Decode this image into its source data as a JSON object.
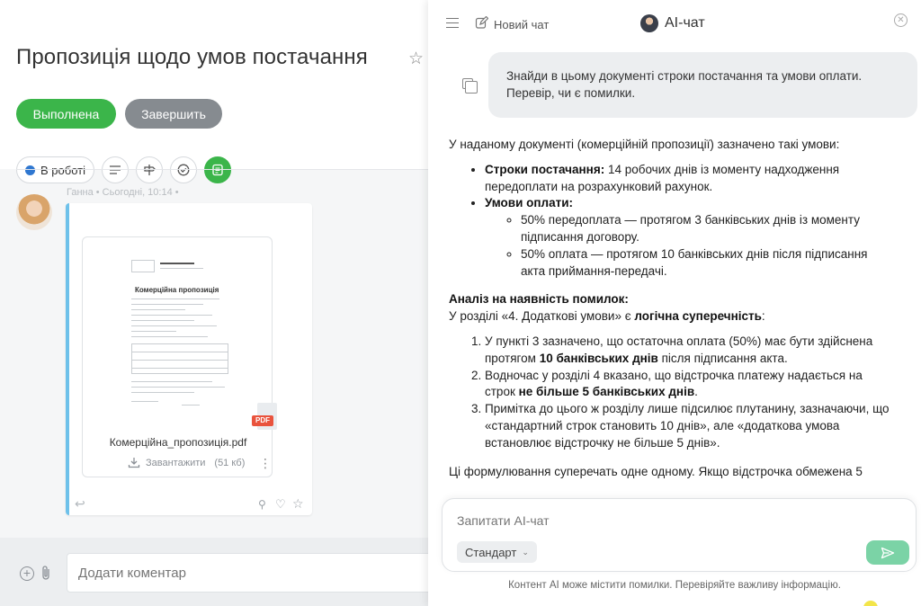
{
  "task": {
    "title": "Пропозиція щодо умов постачання",
    "done_button": "Выполнена",
    "finish_button": "Завершить",
    "status_label": "В роботі",
    "comment_author_meta": "Ганна • Сьогодні, 10:14 •",
    "file": {
      "preview_title": "Комерційна пропозиція",
      "name": "Комерційна_пропозиція.pdf",
      "type_badge": "PDF",
      "download_label": "Завантажити",
      "size": "(51 кб)"
    },
    "comment_placeholder": "Додати коментар"
  },
  "ai_chat": {
    "new_chat_label": "Новий чат",
    "title": "AI-чат",
    "user_message": "Знайди в цьому документі строки постачання та умови оплати. Перевір, чи є помилки.",
    "answer": {
      "intro": "У наданому документі (комерційній пропозиції) зазначено такі умови:",
      "delivery_label": "Строки постачання:",
      "delivery_text": " 14 робочих днів із моменту надходження передоплати на розрахунковий рахунок.",
      "payment_label": "Умови оплати:",
      "payment_items": [
        "50% передоплата — протягом 3 банківських днів із моменту підписання договору.",
        "50% оплата — протягом 10 банківських днів після підписання акта приймання-передачі."
      ],
      "analysis_title": "Аналіз на наявність помилок:",
      "analysis_lead": "У розділі «4. Додаткові умови» є ",
      "analysis_bold": "логічна суперечність",
      "analysis_end": ":",
      "point1_a": "У пункті 3 зазначено, що остаточна оплата (50%) має бути здійснена протягом ",
      "point1_b": "10 банківських днів",
      "point1_c": " після підписання акта.",
      "point2_a": "Водночас у розділі 4 вказано, що відстрочка платежу надається на строк ",
      "point2_b": "не більше 5 банківських днів",
      "point2_c": ".",
      "point3": "Примітка до цього ж розділу лише підсилює плутанину, зазначаючи, що «стандартний строк становить 10 днів», але «додаткова умова встановлює відстрочку не більше 5 днів».",
      "conclusion": "Ці формулювання суперечать одне одному. Якщо відстрочка обмежена 5"
    },
    "input_placeholder": "Запитати AI-чат",
    "model_label": "Стандарт",
    "disclaimer": "Контент AI може містити помилки. Перевіряйте важливу інформацію."
  },
  "colors": {
    "accent_green": "#3bb54a",
    "send_green": "#7bd3a6",
    "status_blue": "#2f77d0",
    "pdf_red": "#e9533d",
    "quote_bar": "#6ec1ea"
  }
}
